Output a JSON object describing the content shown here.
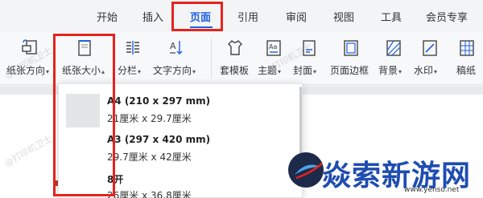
{
  "tabs": [
    {
      "label": "开始"
    },
    {
      "label": "插入"
    },
    {
      "label": "页面",
      "active": true
    },
    {
      "label": "引用"
    },
    {
      "label": "审阅"
    },
    {
      "label": "视图"
    },
    {
      "label": "工具"
    },
    {
      "label": "会员专享"
    }
  ],
  "ribbon": {
    "paper_direction": "纸张方向",
    "paper_size": "纸张大小",
    "columns": "分栏",
    "text_direction": "文字方向",
    "template": "套模板",
    "theme": "主题",
    "cover": "封面",
    "page_border": "页面边框",
    "background": "背景",
    "watermark": "水印",
    "draft": "稿纸"
  },
  "dropdown": {
    "items": [
      {
        "name": "A4 (210 x 297 mm)",
        "size": "21厘米 x 29.7厘米"
      },
      {
        "name": "A3 (297 x 420 mm)",
        "size": "29.7厘米 x 42厘米"
      },
      {
        "name": "8开",
        "size": "26厘米 x 36.8厘米"
      }
    ]
  },
  "watermarks": [
    "@打印机卫士",
    "@打印机卫士",
    "@打印机卫士"
  ],
  "brand": {
    "name": "焱索新游网",
    "url": "www.yenso.net"
  },
  "colors": {
    "accent": "#1f5fe0",
    "highlight": "#e5231d"
  }
}
